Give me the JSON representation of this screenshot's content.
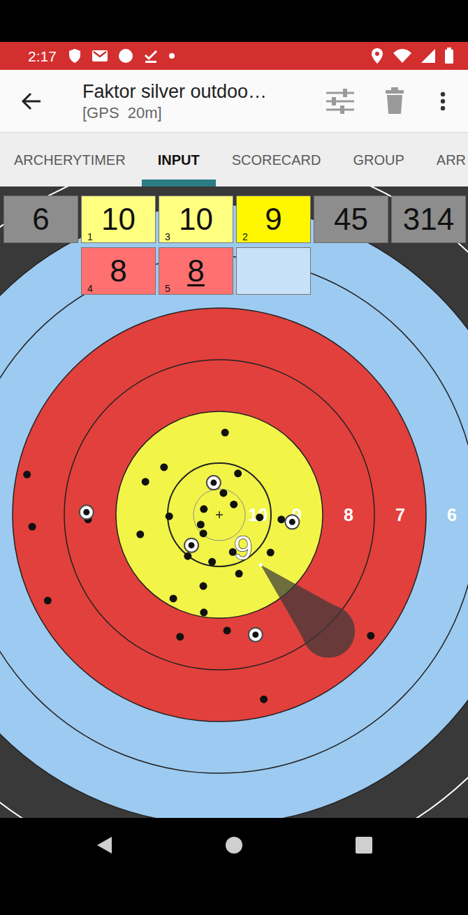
{
  "status_bar": {
    "time": "2:17"
  },
  "app_bar": {
    "title": "Faktor silver outdoo…",
    "subtitle": "[GPS  20m]"
  },
  "tabs": [
    {
      "label": "ARCHERYTIMER",
      "selected": false
    },
    {
      "label": "INPUT",
      "selected": true
    },
    {
      "label": "SCORECARD",
      "selected": false
    },
    {
      "label": "GROUP",
      "selected": false
    },
    {
      "label": "ARR",
      "selected": false
    }
  ],
  "end": {
    "number": "6",
    "total": "45",
    "running_total": "314",
    "slots": [
      {
        "kind": "arrow",
        "value": "10",
        "shot": "1",
        "color": "#ffff80",
        "underlined": false
      },
      {
        "kind": "arrow",
        "value": "10",
        "shot": "3",
        "color": "#ffff80",
        "underlined": false
      },
      {
        "kind": "arrow",
        "value": "9",
        "shot": "2",
        "color": "#fff700",
        "underlined": false
      },
      {
        "kind": "arrow",
        "value": "8",
        "shot": "4",
        "color": "#ff7070",
        "underlined": false
      },
      {
        "kind": "arrow",
        "value": "8",
        "shot": "5",
        "color": "#ff7070",
        "underlined": true
      },
      {
        "kind": "empty",
        "color": "#c6e1f8"
      }
    ]
  },
  "target": {
    "ring_labels": [
      "10",
      "9",
      "8",
      "7",
      "6"
    ],
    "past_arrows": [
      [
        0.11,
        -1.59
      ],
      [
        -1.07,
        -0.92
      ],
      [
        -1.43,
        -0.64
      ],
      [
        0.36,
        -0.8
      ],
      [
        0.08,
        -0.42
      ],
      [
        0.28,
        -0.2
      ],
      [
        -0.3,
        -0.11
      ],
      [
        -0.97,
        0.03
      ],
      [
        0.78,
        0.05
      ],
      [
        1.2,
        0.09
      ],
      [
        -0.36,
        0.19
      ],
      [
        -0.31,
        0.36
      ],
      [
        -1.53,
        0.38
      ],
      [
        -0.61,
        0.8
      ],
      [
        -0.14,
        0.91
      ],
      [
        0.26,
        0.72
      ],
      [
        0.99,
        0.73
      ],
      [
        0.38,
        1.14
      ],
      [
        -0.31,
        1.38
      ],
      [
        -0.89,
        1.62
      ],
      [
        -0.3,
        1.89
      ],
      [
        0.15,
        2.24
      ],
      [
        -0.76,
        2.36
      ],
      [
        -3.72,
        -0.78
      ],
      [
        -3.62,
        0.23
      ],
      [
        -3.32,
        1.66
      ],
      [
        -2.54,
        0.09
      ],
      [
        0.86,
        3.57
      ],
      [
        2.93,
        2.34
      ]
    ],
    "end_arrows": [
      [
        -0.11,
        -0.62
      ],
      [
        -2.57,
        -0.05
      ],
      [
        -0.54,
        0.59
      ],
      [
        1.41,
        0.14
      ],
      [
        0.7,
        2.32
      ]
    ],
    "pending": {
      "score": "9",
      "x": 0.8,
      "y": 0.97
    }
  }
}
